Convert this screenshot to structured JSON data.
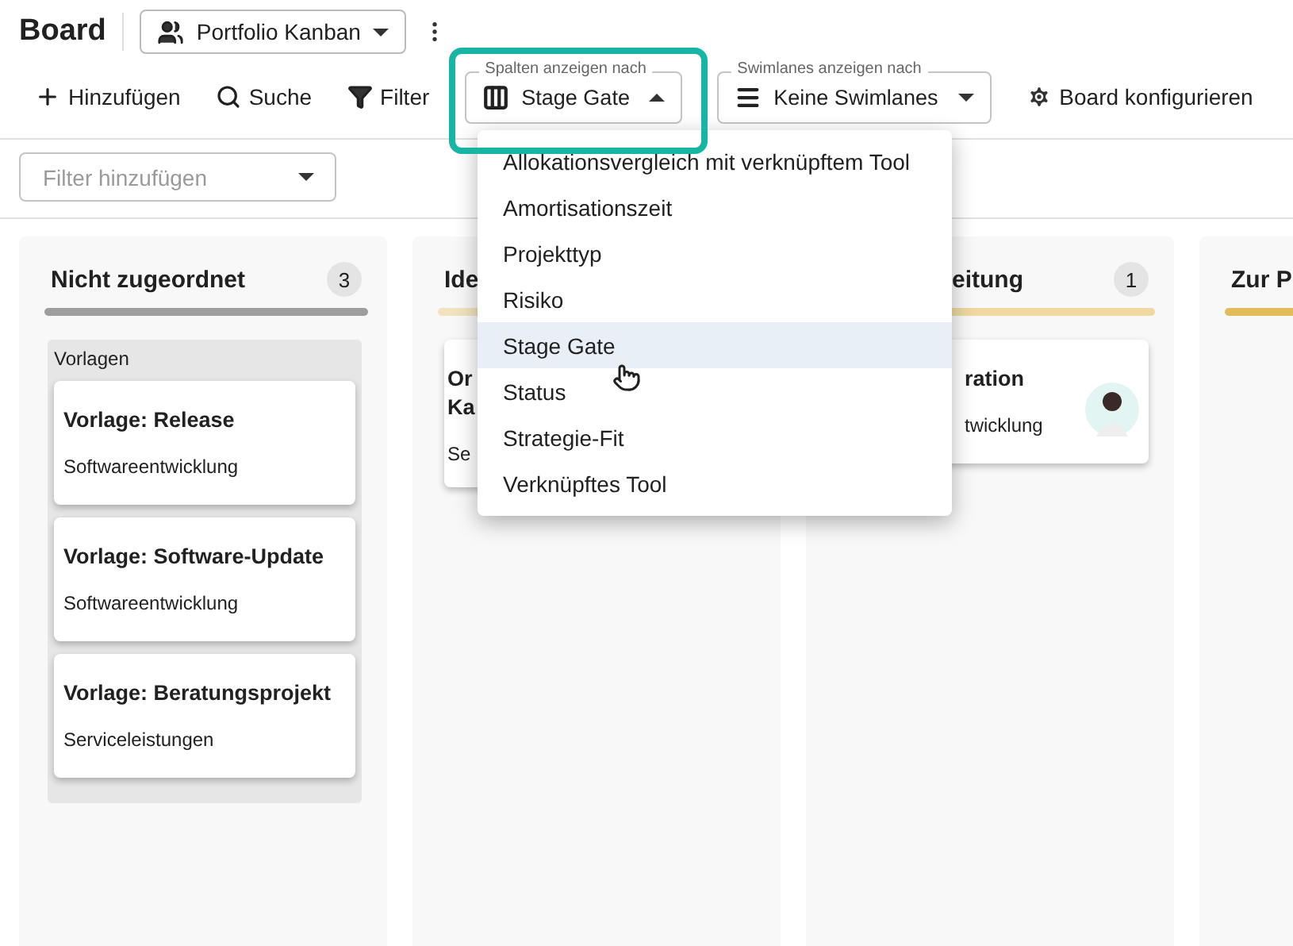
{
  "header": {
    "title": "Board",
    "view_select": "Portfolio Kanban"
  },
  "toolbar": {
    "actions": [
      {
        "kind": "add",
        "label": "Hinzufügen"
      },
      {
        "kind": "search",
        "label": "Suche"
      },
      {
        "kind": "filter",
        "label": "Filter"
      }
    ],
    "column_select": {
      "label": "Spalten anzeigen nach",
      "value": "Stage Gate",
      "expanded": true
    },
    "swimlane_select": {
      "label": "Swimlanes anzeigen nach",
      "value": "Keine Swimlanes",
      "expanded": false
    },
    "configure": "Board konfigurieren"
  },
  "filter": {
    "placeholder": "Filter hinzufügen"
  },
  "menu": [
    {
      "label": "Allokationsvergleich mit verknüpftem Tool",
      "selected": false
    },
    {
      "label": "Amortisationszeit",
      "selected": false
    },
    {
      "label": "Projekttyp",
      "selected": false
    },
    {
      "label": "Risiko",
      "selected": false
    },
    {
      "label": "Stage Gate",
      "selected": true
    },
    {
      "label": "Status",
      "selected": false
    },
    {
      "label": "Strategie-Fit",
      "selected": false
    },
    {
      "label": "Verknüpftes Tool",
      "selected": false
    }
  ],
  "columns": [
    {
      "title": "Nicht zugeordnet",
      "count": "3",
      "color": "#9e9e9e",
      "group": "Vorlagen",
      "cards": [
        {
          "title": "Vorlage: Release",
          "subtitle": "Softwareentwicklung"
        },
        {
          "title": "Vorlage: Software-Update",
          "subtitle": "Softwareentwicklung"
        },
        {
          "title": "Vorlage: Beratungsprojekt",
          "subtitle": "Serviceleistungen"
        }
      ]
    },
    {
      "title": "Ide",
      "color": "#f1e3bf",
      "cards": [
        {
          "title": "Or\nKa",
          "subtitle": "Se"
        }
      ]
    },
    {
      "title": "eitung",
      "count": "1",
      "color": "#efd9a0",
      "cards": [
        {
          "title": "ration",
          "subtitle": "twicklung",
          "avatar": true
        }
      ]
    },
    {
      "title": "Zur P",
      "color": "#e2bc58"
    }
  ]
}
